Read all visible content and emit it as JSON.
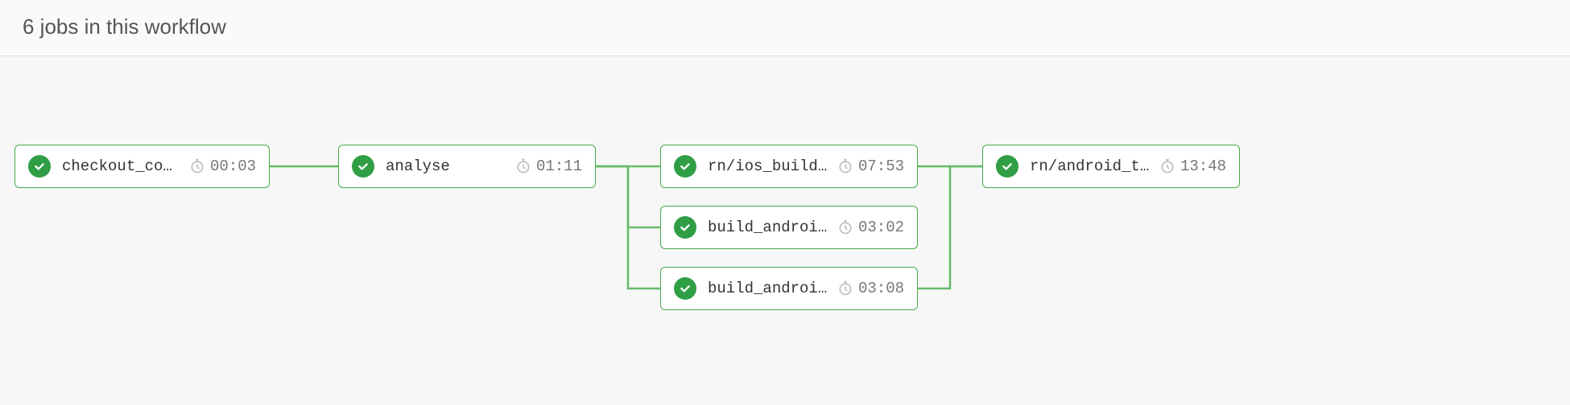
{
  "header": {
    "title": "6 jobs in this workflow"
  },
  "colors": {
    "success": "#2f9e44",
    "node_border": "#48a948",
    "connector": "#66bb6a"
  },
  "jobs": {
    "checkout_code": {
      "name": "checkout_code",
      "duration": "00:03",
      "status": "success"
    },
    "analyse": {
      "name": "analyse",
      "duration": "01:11",
      "status": "success"
    },
    "ios_build": {
      "name": "rn/ios_build…",
      "duration": "07:53",
      "status": "success"
    },
    "build_android_1": {
      "name": "build_androi…",
      "duration": "03:02",
      "status": "success"
    },
    "build_android_2": {
      "name": "build_androi…",
      "duration": "03:08",
      "status": "success"
    },
    "android_t": {
      "name": "rn/android_t…",
      "duration": "13:48",
      "status": "success"
    }
  }
}
